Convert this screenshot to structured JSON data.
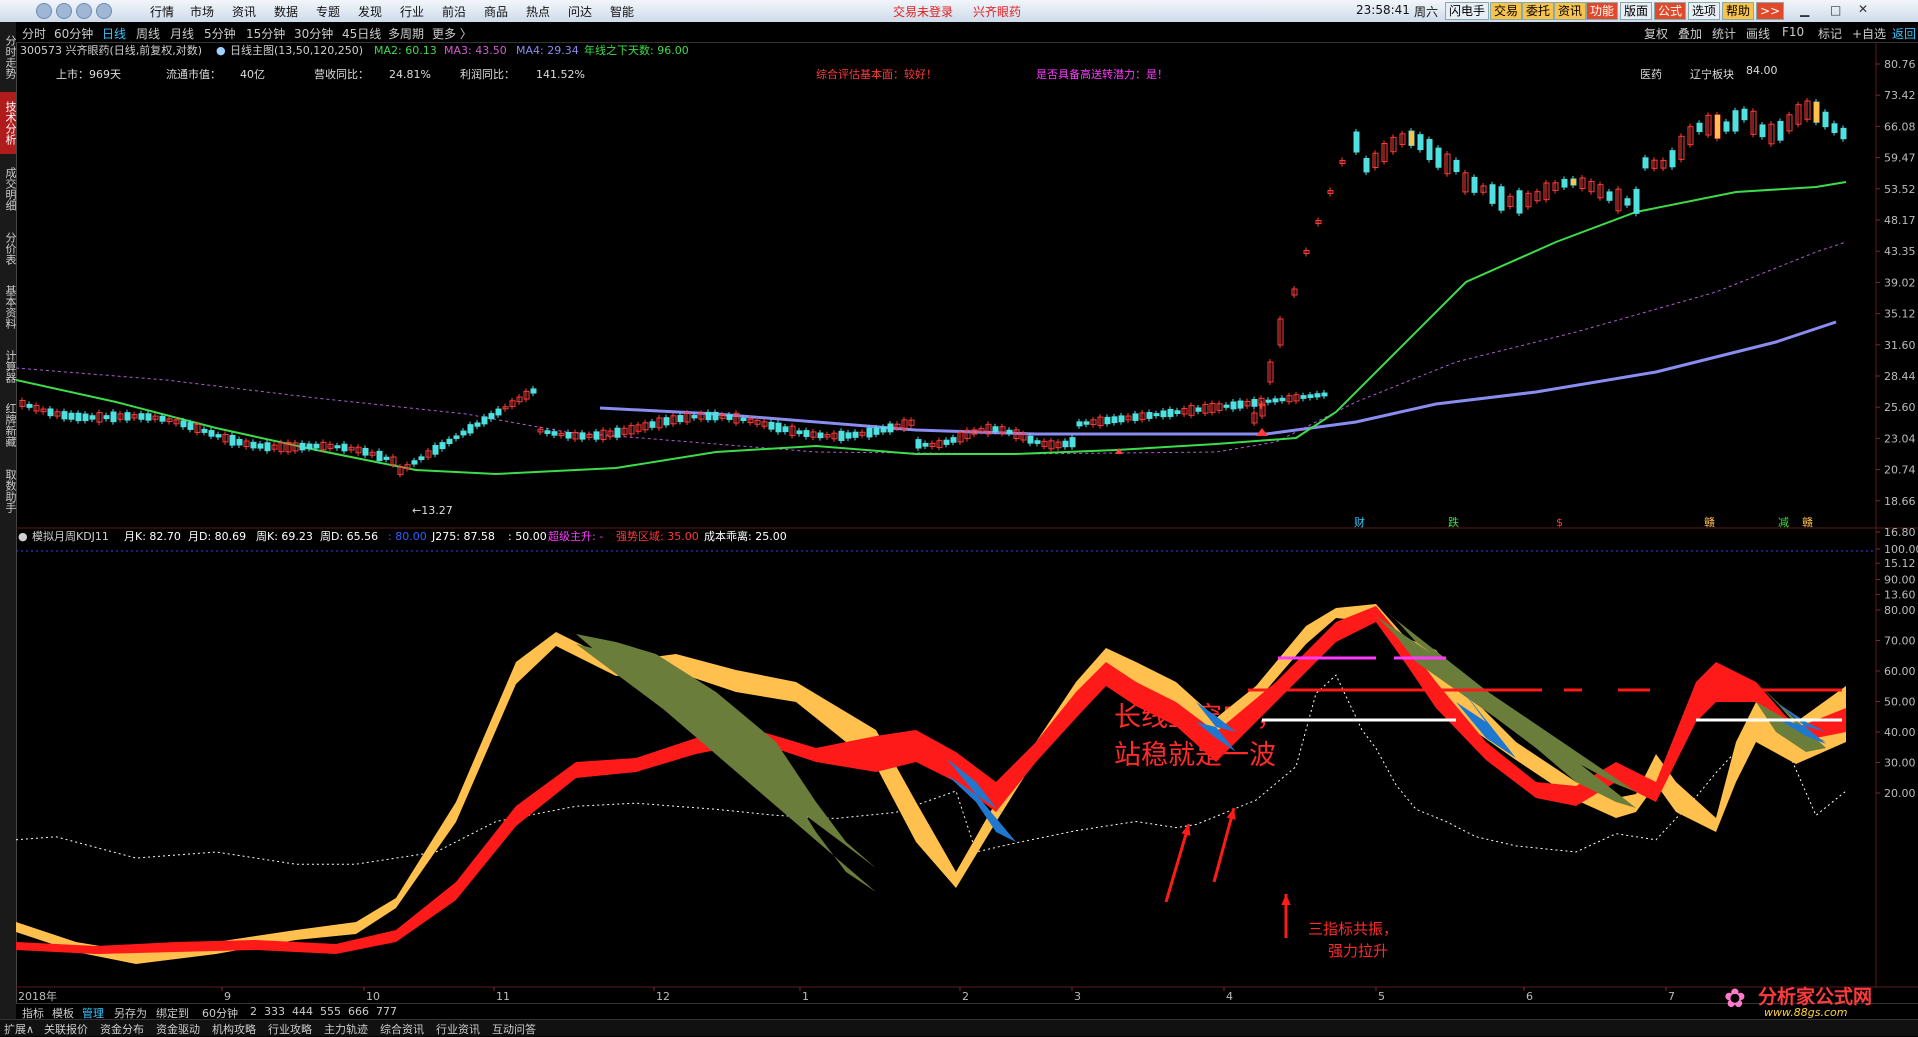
{
  "topbar": {
    "menus": [
      "行情",
      "市场",
      "资讯",
      "数据",
      "专题",
      "发现",
      "行业",
      "前沿",
      "商品",
      "热点",
      "问达",
      "智能"
    ],
    "login_status": "交易未登录",
    "stock_name": "兴齐眼药",
    "clock": "23:58:41",
    "weekday": "周六",
    "right_buttons": [
      "闪电手",
      "交易",
      "委托",
      "资讯",
      "功能",
      "版面",
      "公式",
      "选项",
      "帮助",
      ">>"
    ]
  },
  "period_bar": {
    "items": [
      "分时",
      "60分钟",
      "日线",
      "周线",
      "月线",
      "5分钟",
      "15分钟",
      "30分钟",
      "45日线",
      "多周期",
      "更多 〉"
    ],
    "active": "日线",
    "right_items": [
      "复权",
      "叠加",
      "统计",
      "画线",
      "F10",
      "标记",
      "+自选",
      "返回"
    ]
  },
  "sidebar": {
    "tabs": [
      "分时走势",
      "技术分析",
      "成交明细",
      "分价表",
      "基本资料",
      "计算器",
      "红牌新藏",
      "取数助手"
    ],
    "active": "技术分析"
  },
  "main_chart": {
    "title": "300573 兴齐眼药(日线,前复权,对数)",
    "indicator": "日线主图(13,50,120,250)",
    "ma2": "MA2: 60.13",
    "ma3": "MA3: 43.50",
    "ma4": "MA4: 29.34",
    "below_year_line": "年线之下天数: 96.00",
    "info_labels": [
      "上市：969天",
      "流通市值：",
      "40亿",
      "营收同比：",
      "24.81%",
      "利润同比：",
      "141.52%"
    ],
    "eval_text": "综合评估基本面：较好！",
    "potential_text": "是否具备高送转潜力：是！",
    "industry": "医药",
    "region": "辽宁板块",
    "high_label": "84.00",
    "low_label": "←13.27",
    "markers": [
      "财",
      "跌",
      "$",
      "赣",
      "减",
      "赣"
    ],
    "y_ticks": [
      "80.76",
      "73.42",
      "66.08",
      "59.47",
      "53.52",
      "48.17",
      "43.35",
      "39.02",
      "35.12",
      "31.60",
      "28.44",
      "25.60",
      "23.04",
      "20.74",
      "18.66",
      "16.80",
      "15.12",
      "13.60"
    ]
  },
  "lower_chart": {
    "title": "模拟月周KDJ11",
    "month_k": "月K: 82.70",
    "month_d": "月D: 80.69",
    "week_k": "周K: 69.23",
    "week_d": "周D: 65.56",
    "val80": ": 80.00",
    "j275": "J275: 87.58",
    "val50": ": 50.00",
    "super_main": "超级主升: -",
    "strong_zone": "强势区域: 35.00",
    "cost_dev": "成本乖离: 25.00",
    "y_ticks": [
      "100.00",
      "90.00",
      "80.00",
      "70.00",
      "60.00",
      "50.00",
      "40.00",
      "30.00",
      "20.00"
    ],
    "annotation_line1": "长线上穿50，",
    "annotation_line2": "站稳就是一波",
    "annotation2_line1": "三指标共振，",
    "annotation2_line2": "强力拉升"
  },
  "x_axis": {
    "labels": [
      "2018年",
      "9",
      "10",
      "11",
      "12",
      "1",
      "2",
      "3",
      "4",
      "5",
      "6",
      "7"
    ]
  },
  "bottom_tabs": {
    "row1": [
      "指标",
      "模板",
      "管理",
      "另存为",
      "绑定到",
      "60分钟",
      "2",
      "333",
      "444",
      "555",
      "666",
      "777"
    ],
    "row2": [
      "扩展∧",
      "关联报价",
      "资金分布",
      "资金驱动",
      "机构攻略",
      "行业攻略",
      "主力轨迹",
      "综合资讯",
      "行业资讯",
      "互动问答"
    ]
  },
  "watermark": {
    "site_name": "分析家公式网",
    "url": "www.88gs.com"
  },
  "colors": {
    "ma_green": "#3ddc4a",
    "ma_purple": "#b05cd0",
    "ma_blue": "#8a8cf0",
    "up_red": "#ff3b3b",
    "down_cyan": "#4fe0e0",
    "yellow": "#ffc04d",
    "kdj_red": "#ff1a1a",
    "kdj_blue": "#1f78d0",
    "kdj_olive": "#6b7d3a"
  }
}
